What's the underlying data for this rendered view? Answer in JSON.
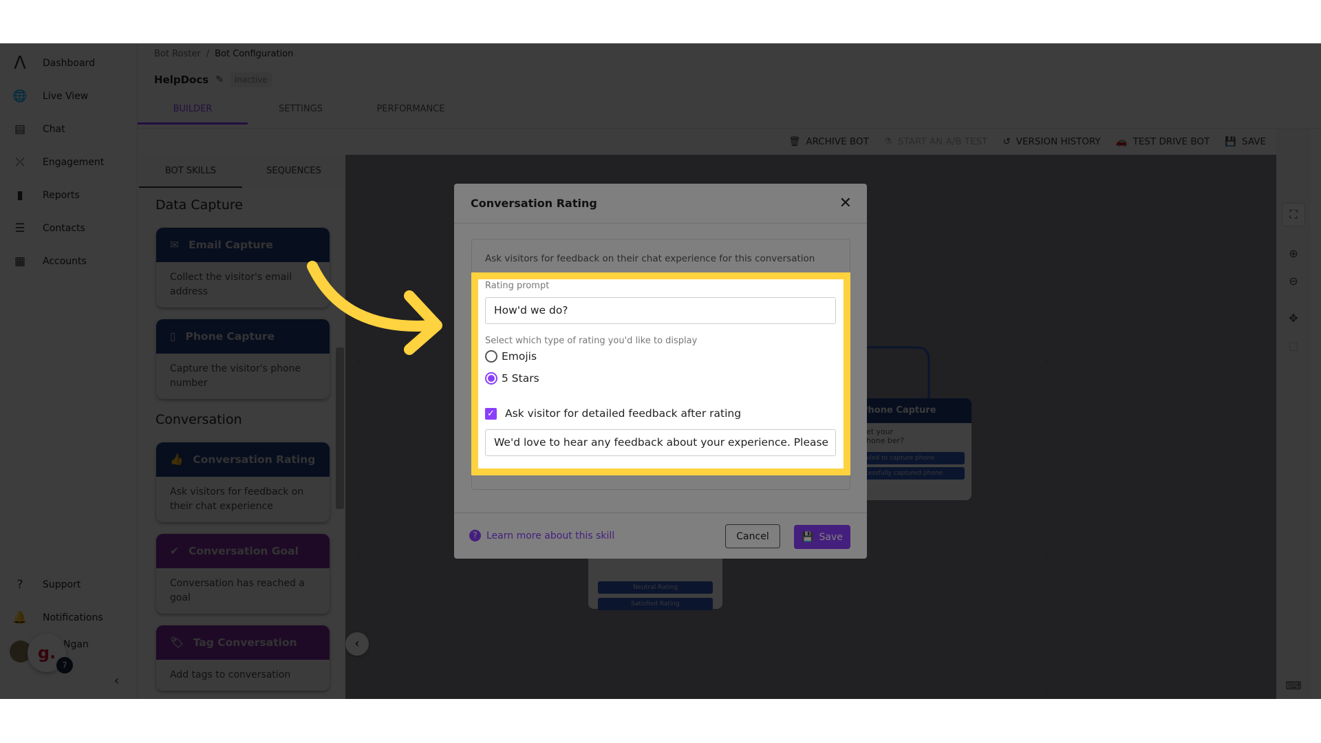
{
  "colors": {
    "accent": "#8a3ffc",
    "highlight": "#ffd23f",
    "node_header": "#1f3a7a"
  },
  "sidebar": {
    "items": [
      {
        "label": "Dashboard",
        "icon": "logo-icon"
      },
      {
        "label": "Live View",
        "icon": "globe-search-icon"
      },
      {
        "label": "Chat",
        "icon": "chat-icon"
      },
      {
        "label": "Engagement",
        "icon": "strategy-icon"
      },
      {
        "label": "Reports",
        "icon": "bar-chart-icon"
      },
      {
        "label": "Contacts",
        "icon": "contacts-icon"
      },
      {
        "label": "Accounts",
        "icon": "building-icon"
      }
    ],
    "bottom": [
      {
        "label": "Support",
        "icon": "help-icon"
      },
      {
        "label": "Notifications",
        "icon": "bell-icon"
      }
    ],
    "user": {
      "name": "Ngan",
      "badge": "g.",
      "count": "7"
    }
  },
  "header": {
    "breadcrumb": [
      "Bot Roster",
      "Bot Configuration"
    ],
    "bot_name": "HelpDocs",
    "status": "Inactive",
    "tabs": [
      "BUILDER",
      "SETTINGS",
      "PERFORMANCE"
    ],
    "active_tab": "BUILDER"
  },
  "toolbar": {
    "archive": "ARCHIVE BOT",
    "ab_test": "START AN A/B TEST",
    "history": "VERSION HISTORY",
    "test_drive": "TEST DRIVE BOT",
    "save": "SAVE"
  },
  "panel": {
    "tabs": [
      "BOT SKILLS",
      "SEQUENCES"
    ],
    "sections": [
      {
        "title": "Data Capture",
        "cards": [
          {
            "title": "Email Capture",
            "desc": "Collect the visitor's email address"
          },
          {
            "title": "Phone Capture",
            "desc": "Capture the visitor's phone number"
          }
        ]
      },
      {
        "title": "Conversation",
        "cards": [
          {
            "title": "Conversation Rating",
            "desc": "Ask visitors for feedback on their chat experience"
          },
          {
            "title": "Conversation Goal",
            "desc": "Conversation has reached a goal"
          },
          {
            "title": "Tag Conversation",
            "desc": "Add tags to conversation"
          }
        ]
      }
    ]
  },
  "canvas": {
    "phone_node": {
      "title": "Phone Capture",
      "text": "get your phone ber?",
      "outputs": [
        "Failed to capture phone",
        "ccessfully captured phone"
      ]
    },
    "rating_node": {
      "outputs": [
        "Neutral Rating",
        "Satisfied Rating"
      ]
    }
  },
  "modal": {
    "title": "Conversation Rating",
    "description": "Ask visitors for feedback on their chat experience for this conversation",
    "prompt_label": "Rating prompt",
    "prompt_value": "How'd we do?",
    "type_label": "Select which type of rating you'd like to display",
    "options": [
      "Emojis",
      "5 Stars"
    ],
    "selected": "5 Stars",
    "feedback_checkbox": "Ask visitor for detailed feedback after rating",
    "feedback_checked": true,
    "feedback_value": "We'd love to hear any feedback about your experience. Please",
    "learn_more": "Learn more about this skill",
    "cancel": "Cancel",
    "save": "Save"
  }
}
